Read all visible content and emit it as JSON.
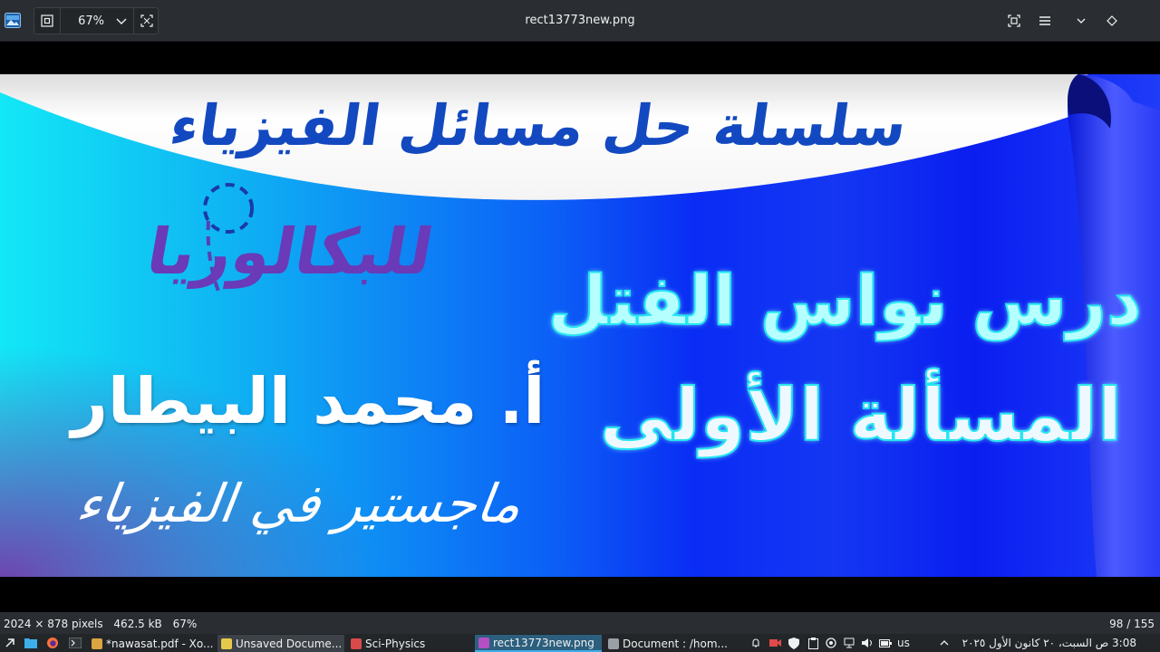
{
  "toolbar": {
    "zoom_value": "67%",
    "window_title": "rect13773new.png"
  },
  "image_content": {
    "series_title": "سلسلة حل مسائل الفيزياء",
    "baccalaureate": "للبكالوريا",
    "lesson_title": "درس نواس الفتل",
    "problem_title": "المسألة الأولى",
    "teacher_name": "أ. محمد البيطار",
    "teacher_degree": "ماجستير في الفيزياء"
  },
  "statusbar": {
    "dimensions": "2024 × 878 pixels",
    "file_size": "462.5 kB",
    "zoom": "67%",
    "page_counter": "98 / 155"
  },
  "taskbar": {
    "tasks": [
      {
        "label": "*nawasat.pdf - Xo...",
        "icon_color": "#d9a441"
      },
      {
        "label": "Unsaved Docume...",
        "icon_color": "#e6c94a"
      },
      {
        "label": "Sci-Physics",
        "icon_color": "#d94a4a"
      },
      {
        "label": "rect13773new.png",
        "icon_color": "#b44fc4"
      },
      {
        "label": "Document : /hom...",
        "icon_color": "#9aa0a6"
      }
    ],
    "keyboard_layout": "us",
    "clock": "3:08 ص  السبت، ٢٠ كانون الأول ٢٠٢٥"
  },
  "colors": {
    "toolbar_bg": "#2a2e32",
    "accent": "#3daee9",
    "series_text": "#1349c0",
    "bacc_text": "#6a3ab8",
    "lesson_text_stroke": "#25e6f0"
  },
  "icons": [
    "app-viewer-icon",
    "fit-icon",
    "chevron-down-icon",
    "fullscreen-icon",
    "crop-icon",
    "hamburger-menu-icon",
    "minimize-icon",
    "keep-above-icon",
    "application-launcher-icon",
    "files-icon",
    "firefox-icon",
    "terminal-icon"
  ]
}
